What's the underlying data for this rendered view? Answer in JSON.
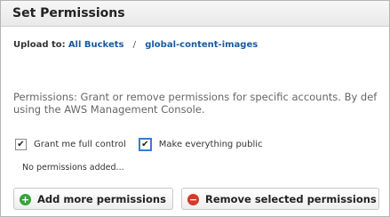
{
  "dialog": {
    "title": "Set Permissions"
  },
  "upload": {
    "label": "Upload to:",
    "breadcrumb": [
      "All Buckets",
      "global-content-images"
    ],
    "separator": "/"
  },
  "description": {
    "line1": "Permissions: Grant or remove permissions for specific accounts. By def",
    "line2": "using the AWS Management Console."
  },
  "options": {
    "grant_full_control": {
      "label": "Grant me full control",
      "checked": true
    },
    "make_public": {
      "label": "Make everything public",
      "checked": true
    }
  },
  "permissions_list": {
    "empty_text": "No permissions added..."
  },
  "actions": {
    "add_label": "Add more permissions",
    "remove_label": "Remove selected permissions"
  },
  "icons": {
    "add": "plus-circle-icon",
    "remove": "minus-circle-icon",
    "check": "✔"
  },
  "colors": {
    "link": "#1a5aa0",
    "add_icon": "#3aa23a",
    "remove_icon": "#d43a2a",
    "focus_border": "#3a7bd5"
  }
}
